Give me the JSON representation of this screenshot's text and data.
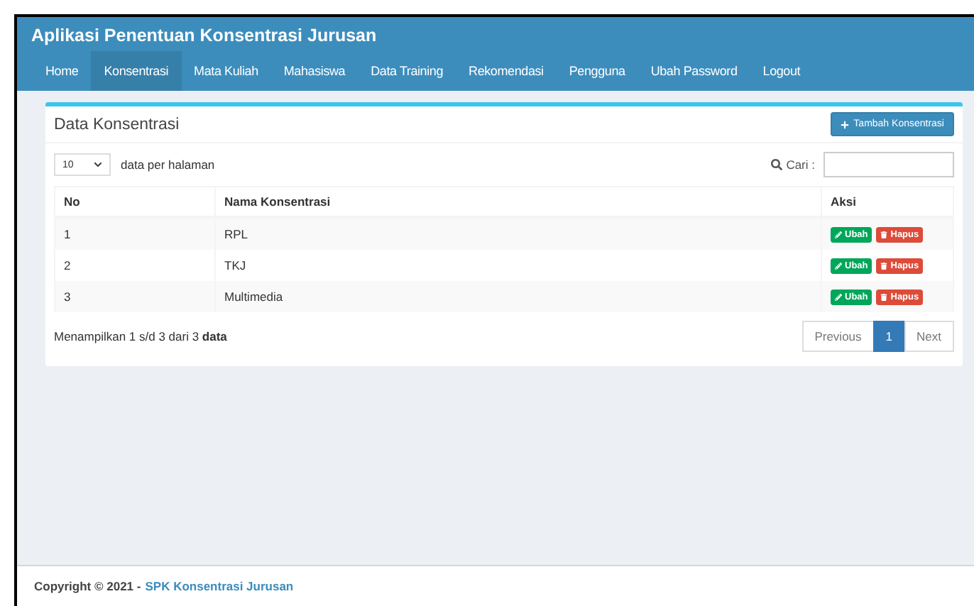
{
  "header": {
    "title": "Aplikasi Penentuan Konsentrasi Jurusan"
  },
  "nav": [
    {
      "label": "Home",
      "selected": false
    },
    {
      "label": "Konsentrasi",
      "selected": true
    },
    {
      "label": "Mata Kuliah",
      "selected": false
    },
    {
      "label": "Mahasiswa",
      "selected": false
    },
    {
      "label": "Data Training",
      "selected": false
    },
    {
      "label": "Rekomendasi",
      "selected": false
    },
    {
      "label": "Pengguna",
      "selected": false
    },
    {
      "label": "Ubah Password",
      "selected": false
    },
    {
      "label": "Logout",
      "selected": false
    }
  ],
  "card": {
    "title": "Data Konsentrasi",
    "add_button": "Tambah Konsentrasi"
  },
  "length": {
    "value": "10",
    "label": "data per halaman"
  },
  "search": {
    "label": "Cari :"
  },
  "table": {
    "columns": [
      "No",
      "Nama Konsentrasi",
      "Aksi"
    ],
    "rows": [
      {
        "no": "1",
        "name": "RPL",
        "edit": "Ubah",
        "delete": "Hapus"
      },
      {
        "no": "2",
        "name": "TKJ",
        "edit": "Ubah",
        "delete": "Hapus"
      },
      {
        "no": "3",
        "name": "Multimedia",
        "edit": "Ubah",
        "delete": "Hapus"
      }
    ]
  },
  "info": "Menampilkan 1 s/d 3 dari 3 **data**",
  "pagination": [
    {
      "label": "Previous",
      "selected": false
    },
    {
      "label": "1",
      "selected": true
    },
    {
      "label": "Next",
      "selected": false
    }
  ],
  "footer": {
    "text": "Copyright © 2021 -",
    "link": "SPK Konsentrasi Jurusan"
  }
}
